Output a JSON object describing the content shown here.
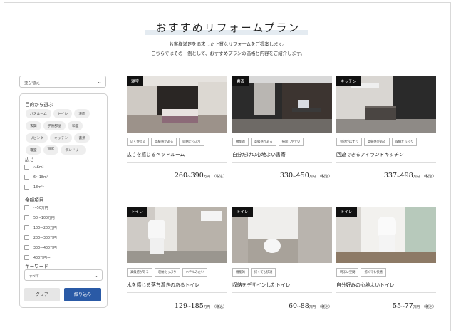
{
  "header": {
    "title": "おすすめリフォームプラン",
    "intro_line1": "お客様満足を追求した上質なリフォームをご提案します。",
    "intro_line2": "こちらではその一例として、おすすめプランの価格と内容をご紹介します。"
  },
  "sidebar": {
    "sort_label": "並び替え",
    "purpose_title": "目的から選ぶ",
    "purpose_tags": [
      "バスルーム",
      "トイレ",
      "洗面",
      "玄関",
      "子供部屋",
      "和室",
      "リビング",
      "キッチン",
      "書斎",
      "寝室",
      "WIC",
      "ランドリー"
    ],
    "area_title": "広さ",
    "area_options": [
      "〜6m²",
      "6〜18m²",
      "18m²〜"
    ],
    "price_title": "金額項目",
    "price_options": [
      "〜50万円",
      "50〜100万円",
      "100〜200万円",
      "200〜300万円",
      "300〜400万円",
      "400万円〜"
    ],
    "keyword_title": "キーワード",
    "keyword_value": "すべて",
    "clear_button": "クリア",
    "filter_button": "絞り込み"
  },
  "cards": [
    {
      "category": "寝室",
      "features": [
        "広く使える",
        "高級感がある",
        "収納たっぷり"
      ],
      "title": "広さを感じるベッドルーム",
      "price_min": "260",
      "price_max": "390",
      "unit": "万円",
      "tax": "（税込）"
    },
    {
      "category": "書斎",
      "features": [
        "機能的",
        "高級感がある",
        "掃除しやすい"
      ],
      "title": "自分だけの心地よい書斎",
      "price_min": "330",
      "price_max": "450",
      "unit": "万円",
      "tax": "（税込）"
    },
    {
      "category": "キッチン",
      "features": [
        "会話がはずむ",
        "高級感がある",
        "収納たっぷり"
      ],
      "title": "回遊できるアイランドキッチン",
      "price_min": "337",
      "price_max": "498",
      "unit": "万円",
      "tax": "（税込）"
    },
    {
      "category": "トイレ",
      "features": [
        "高級感がある",
        "収納たっぷり",
        "ホテルみたい"
      ],
      "title": "木を感じる落ち着きのあるトイレ",
      "price_min": "129",
      "price_max": "185",
      "unit": "万円",
      "tax": "（税込）"
    },
    {
      "category": "トイレ",
      "features": [
        "機能的",
        "掃くても快適"
      ],
      "title": "収納をデザインしたトイレ",
      "price_min": "60",
      "price_max": "88",
      "unit": "万円",
      "tax": "（税込）"
    },
    {
      "category": "トイレ",
      "features": [
        "明るい空間",
        "掃くても快適"
      ],
      "title": "自分好みの心地よいトイレ",
      "price_min": "55",
      "price_max": "77",
      "unit": "万円",
      "tax": "（税込）"
    }
  ],
  "price_separator": "〜"
}
